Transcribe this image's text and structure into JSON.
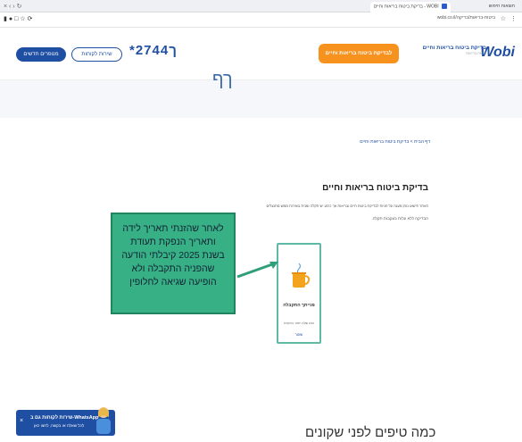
{
  "browser": {
    "tab_active_text": "בדיקת ביטוח בריאות וחיים - WOBI",
    "tab_other_text": "תוצאות חיפוש",
    "url_text": "wobi.co.il/ביטוח-בריאות/בדיקה",
    "window_controls": "×  ‹  ›  ↻"
  },
  "header": {
    "logo": "Wobi",
    "brand_line1": "בדיקת ביטוח בריאות וחיים",
    "brand_line2": "ביטוח בריאות",
    "check_button": "לבדיקת ביטוח בריאות וחיים",
    "phone": "*2744ך",
    "service_button": "שירות לקוחות",
    "new_button": "מנופרים חדשים"
  },
  "hero": {
    "glyph": "ךף"
  },
  "breadcrumb": "דף הבית > בדיקת ביטוח בריאות וחיים",
  "main": {
    "title": "בדיקת ביטוח בריאות וחיים",
    "paragraph": "האתר פישוט נותן מענה על פניות לבדיקת ביטוח חיים ובריאות אך כרגע יש תקלה זמנית בשירות ממש מתנצלים",
    "paragraph2": "הבדיקה ללא עלות בעקבות תקלה."
  },
  "card": {
    "title": "פנייתך התקבלה",
    "subtitle": "נציג שלנו יחזור בהקדם",
    "link": "שוטר"
  },
  "note": {
    "text": "לאחר שהזנתי תאריך לידה ותאריך הנפקת תעודת בשנת 2025 קיבלתי הודעה שהפניה התקבלה ולא הופיעה שגיאה לחלופין"
  },
  "whatsapp": {
    "close": "×",
    "line1": "שירות לקוחות גם ב-WhatsApp",
    "line2": "לכל שאלה או בקשה, לחצו כאן"
  },
  "tips_heading": "כמה טיפים לפני שקונים",
  "colors": {
    "brand_blue": "#1f4fa3",
    "orange": "#f7921e",
    "note_green": "#38b086",
    "card_border": "#5fb9a7"
  }
}
